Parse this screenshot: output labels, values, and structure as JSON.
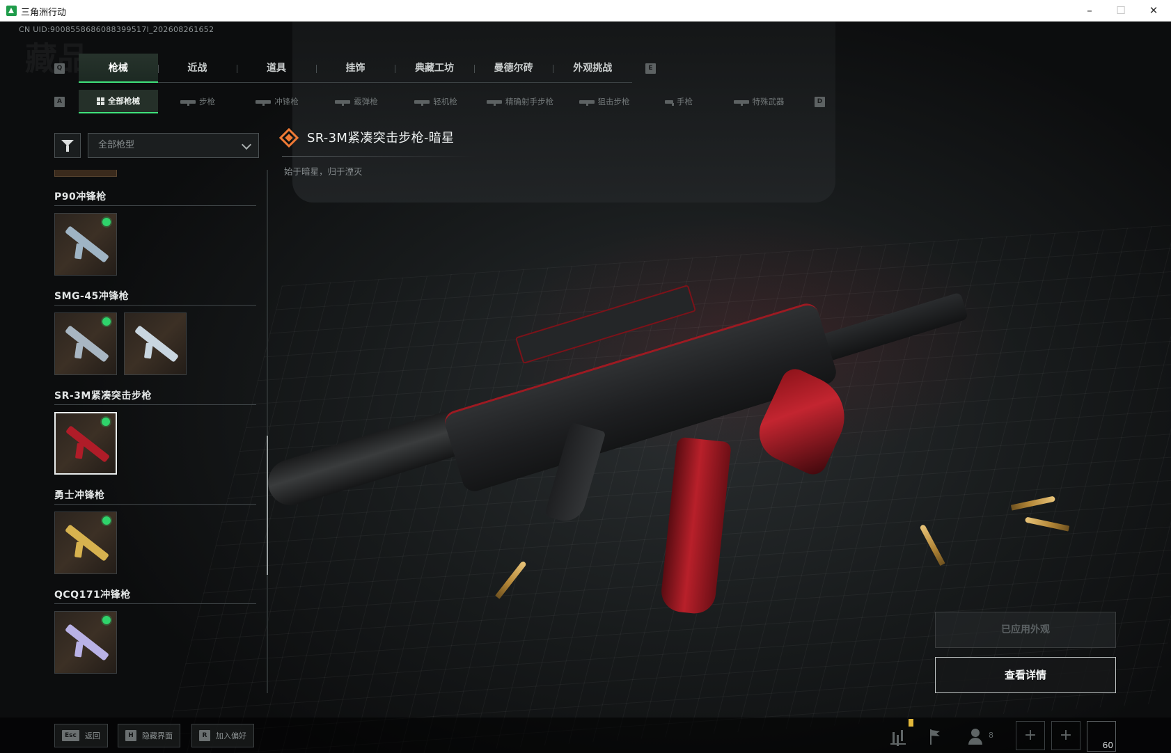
{
  "window": {
    "title": "三角洲行动",
    "minimize": "–",
    "maximize": "☐",
    "close": "✕"
  },
  "uid_text": "CN UID:9008558686088399517l_202608261652",
  "ghost_title": "藏品",
  "main_tabs": {
    "prev_key": "Q",
    "next_key": "E",
    "items": [
      {
        "label": "枪械",
        "active": true
      },
      {
        "label": "近战"
      },
      {
        "label": "道具"
      },
      {
        "label": "挂饰"
      },
      {
        "label": "典藏工坊"
      },
      {
        "label": "曼德尔砖"
      },
      {
        "label": "外观挑战"
      }
    ]
  },
  "sub_tabs": {
    "prev_key": "A",
    "next_key": "D",
    "items": [
      {
        "label": "全部枪械",
        "active": true
      },
      {
        "label": "步枪"
      },
      {
        "label": "冲锋枪"
      },
      {
        "label": "霰弹枪"
      },
      {
        "label": "轻机枪"
      },
      {
        "label": "精确射手步枪"
      },
      {
        "label": "狙击步枪"
      },
      {
        "label": "手枪"
      },
      {
        "label": "特殊武器"
      }
    ]
  },
  "filter": {
    "select_value": "全部枪型"
  },
  "weapon_list": [
    {
      "name": "P90冲锋枪",
      "skins": [
        {
          "equipped": true,
          "color": "#9fb4c4"
        }
      ]
    },
    {
      "name": "SMG-45冲锋枪",
      "skins": [
        {
          "equipped": true,
          "color": "#a8b6c2"
        },
        {
          "equipped": false,
          "color": "#c9d6e0"
        }
      ]
    },
    {
      "name": "SR-3M紧凑突击步枪",
      "skins": [
        {
          "equipped": true,
          "selected": true,
          "color": "#b01c28"
        }
      ]
    },
    {
      "name": "勇士冲锋枪",
      "skins": [
        {
          "equipped": true,
          "color": "#d7b24f"
        }
      ]
    },
    {
      "name": "QCQ171冲锋枪",
      "skins": [
        {
          "equipped": true,
          "color": "#b9b2e6"
        }
      ]
    }
  ],
  "selected_item": {
    "name": "SR-3M紧凑突击步枪-暗星",
    "description": "始于暗星，归于湮灭",
    "rarity_color": "#f07a35"
  },
  "actions": {
    "applied_label": "已应用外观",
    "detail_label": "查看详情"
  },
  "hints": [
    {
      "key": "Esc",
      "label": "返回"
    },
    {
      "key": "H",
      "label": "隐藏界面"
    },
    {
      "key": "R",
      "label": "加入偏好"
    }
  ],
  "hud": {
    "friends_count": "8",
    "fps": "60"
  }
}
